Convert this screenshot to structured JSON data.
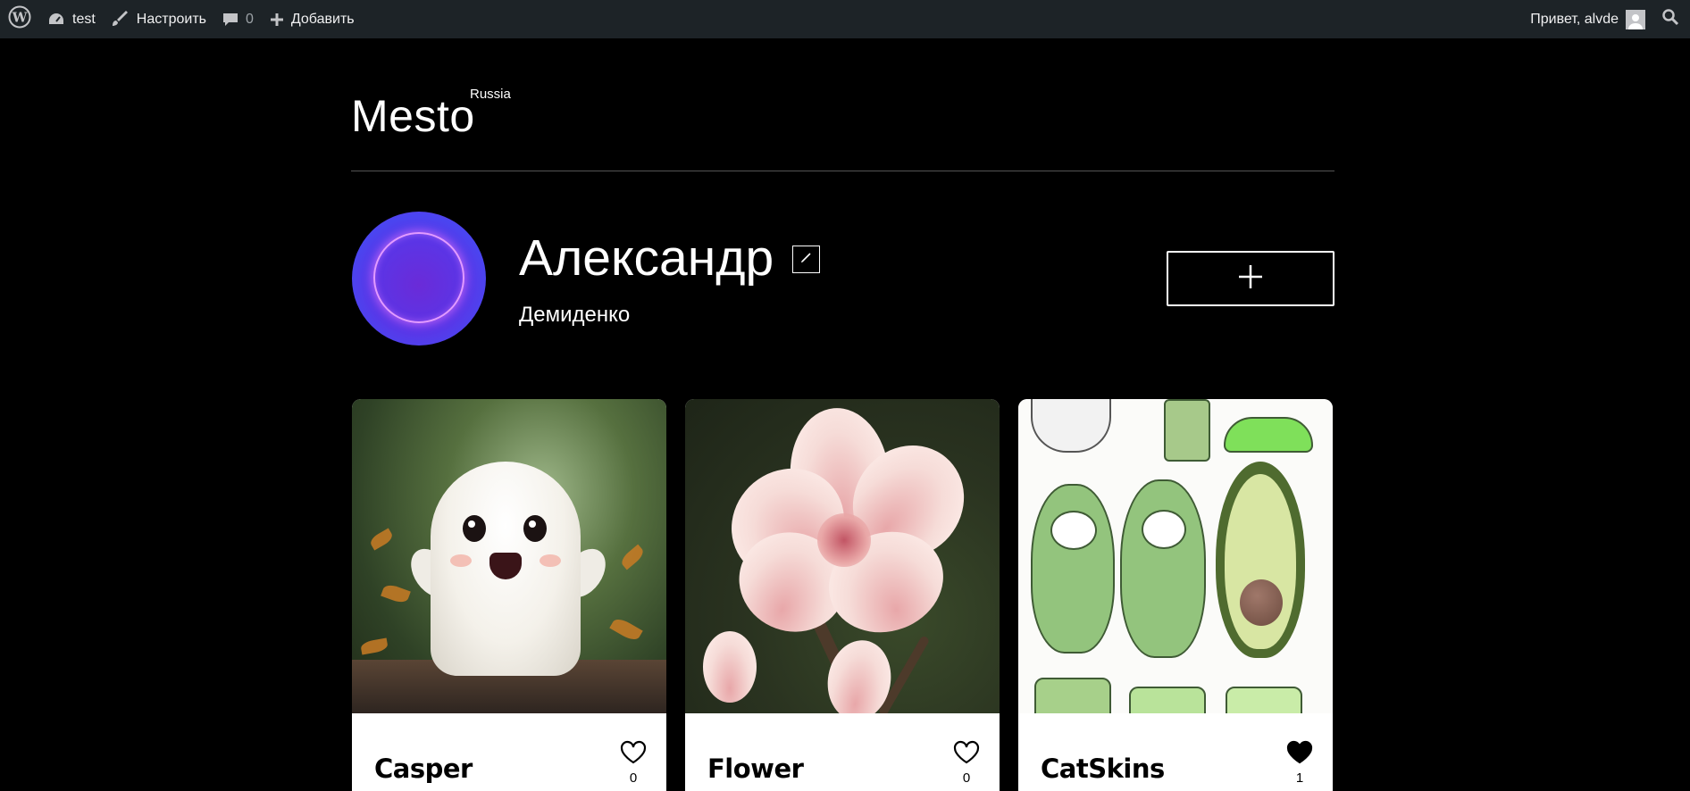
{
  "adminbar": {
    "site_name": "test",
    "customize_label": "Настроить",
    "comments_count": "0",
    "new_label": "Добавить",
    "greeting": "Привет, alvde"
  },
  "header": {
    "logo": "Mesto",
    "logo_sup": "Russia"
  },
  "profile": {
    "name": "Александр",
    "about": "Демиденко"
  },
  "cards": [
    {
      "title": "Casper",
      "likes": "0",
      "liked": false
    },
    {
      "title": "Flower",
      "likes": "0",
      "liked": false
    },
    {
      "title": "CatSkins",
      "likes": "1",
      "liked": true
    }
  ],
  "colors": {
    "adminbar_bg": "#1d2327",
    "page_bg": "#000000",
    "card_bg": "#ffffff"
  }
}
